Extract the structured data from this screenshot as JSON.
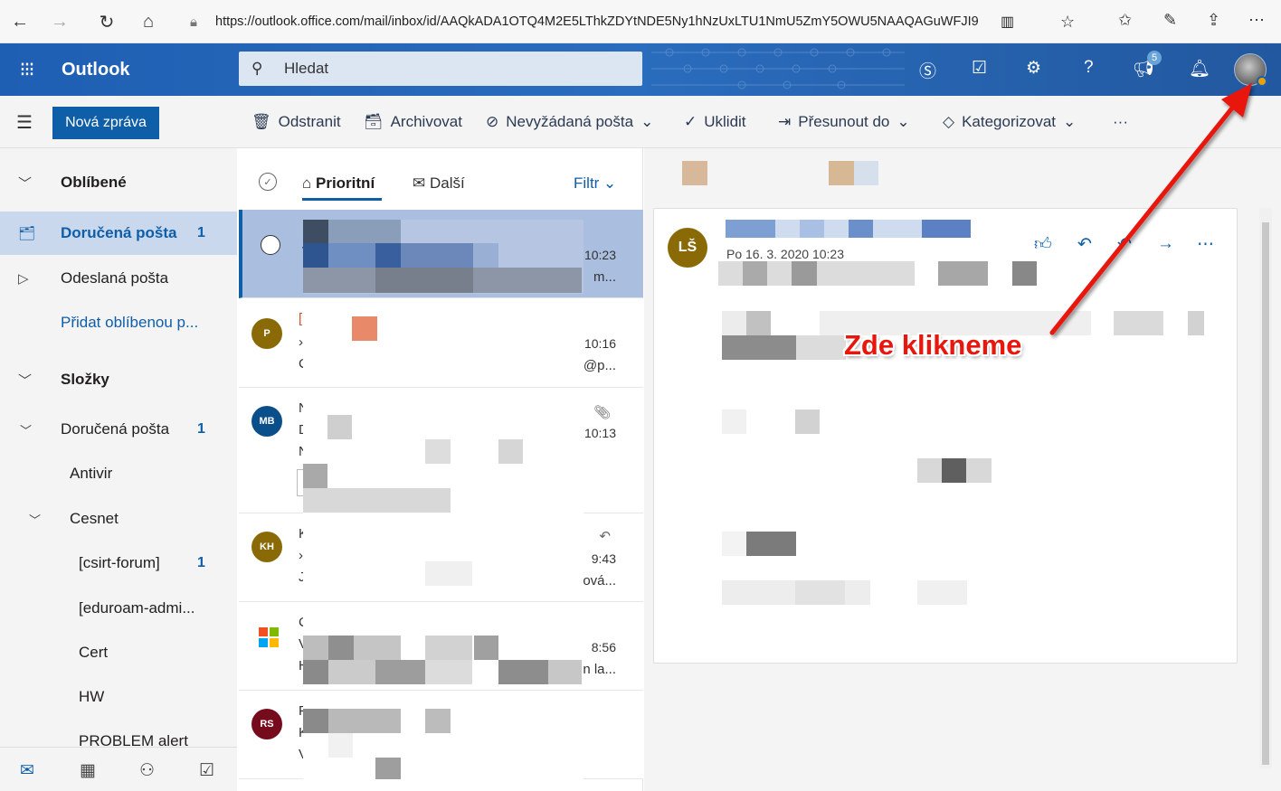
{
  "browser": {
    "url": "https://outlook.office.com/mail/inbox/id/AAQkADA1OTQ4M2E5LThkZDYtNDE5Ny1hNzUxLTU1NmU5ZmY5OWU5NAAQAGuWFJI9"
  },
  "header": {
    "app_name": "Outlook",
    "search_placeholder": "Hledat",
    "notifications_badge": "5"
  },
  "toolbar": {
    "new_message": "Nová zpráva",
    "delete": "Odstranit",
    "archive": "Archivovat",
    "junk": "Nevyžádaná pošta",
    "sweep": "Uklidit",
    "move_to": "Přesunout do",
    "categorize": "Kategorizovat",
    "more": "···"
  },
  "nav": {
    "favorites": "Oblíbené",
    "inbox": "Doručená pošta",
    "inbox_count": "1",
    "sent": "Odeslaná pošta",
    "add_favorite": "Přidat oblíbenou p...",
    "folders": "Složky",
    "folder_inbox": "Doručená pošta",
    "folder_inbox_count": "1",
    "antivir": "Antivir",
    "cesnet": "Cesnet",
    "csirt": "[csirt-forum]",
    "csirt_count": "1",
    "eduroam": "[eduroam-admi...",
    "cert": "Cert",
    "hw": "HW",
    "problem": "PROBLEM alert"
  },
  "list": {
    "tab_focused": "Prioritní",
    "tab_other": "Další",
    "filter": "Filtr",
    "messages": [
      {
        "initials": "",
        "l1": "L",
        "l2": "v",
        "l3": "D",
        "time": "10:23",
        "trail": "m..."
      },
      {
        "initials": "P",
        "l1": "[",
        "l2": "›",
        "l3": "C",
        "time": "10:16",
        "trail": "@p..."
      },
      {
        "initials": "MB",
        "l1": "N",
        "l2": "D",
        "l3": "N",
        "time": "10:13",
        "trail": ""
      },
      {
        "initials": "KH",
        "l1": "K",
        "l2": "›",
        "l3": "J",
        "time": "9:43",
        "trail": "ová..."
      },
      {
        "initials": "",
        "l1": "C",
        "l2": "V",
        "l3": "H",
        "time": "8:56",
        "trail": "n la..."
      },
      {
        "initials": "RS",
        "l1": "F",
        "l2": "K",
        "l3": "V",
        "time": "",
        "trail": ""
      }
    ]
  },
  "reading": {
    "sender_initials": "LŠ",
    "date": "Po 16. 3. 2020 10:23"
  },
  "annotation": {
    "text": "Zde klikneme"
  },
  "colors": {
    "brand_blue": "#0f5ea8",
    "header_blue": "#1d5fb0",
    "annotation_red": "#e8160c"
  }
}
